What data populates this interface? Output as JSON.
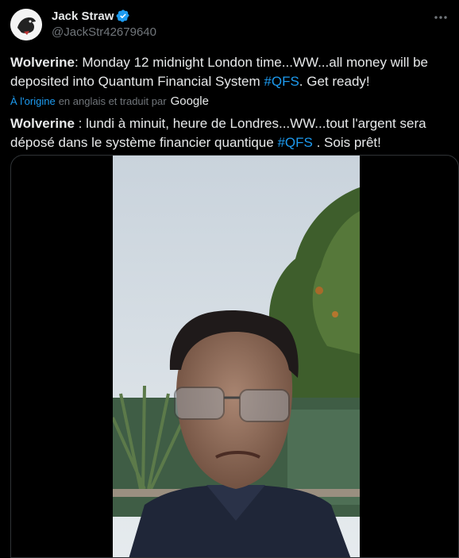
{
  "author": {
    "display_name": "Jack Straw",
    "handle": "@JackStr42679640",
    "avatar_icon": "raven-avatar-icon",
    "verified_icon": "verified-badge-icon"
  },
  "tweet": {
    "original_lead": "Wolverine",
    "original_body": ": Monday 12 midnight London time...WW...all money will be deposited into Quantum Financial System ",
    "original_hashtag": "#QFS",
    "original_tail": ". Get ready!",
    "translation_link": "À l'origine",
    "translation_mid": "en anglais et traduit par",
    "translation_provider": "Google",
    "translated_lead": "Wolverine",
    "translated_body": " : lundi à minuit, heure de Londres...WW...tout l'argent sera déposé dans le système financier quantique ",
    "translated_hashtag": "#QFS",
    "translated_tail": " . Sois prêt!"
  },
  "colors": {
    "background": "#000000",
    "text": "#e7e9ea",
    "secondary": "#71767b",
    "accent": "#1d9bf0"
  },
  "media": {
    "type": "video",
    "icon": "video-thumbnail"
  }
}
